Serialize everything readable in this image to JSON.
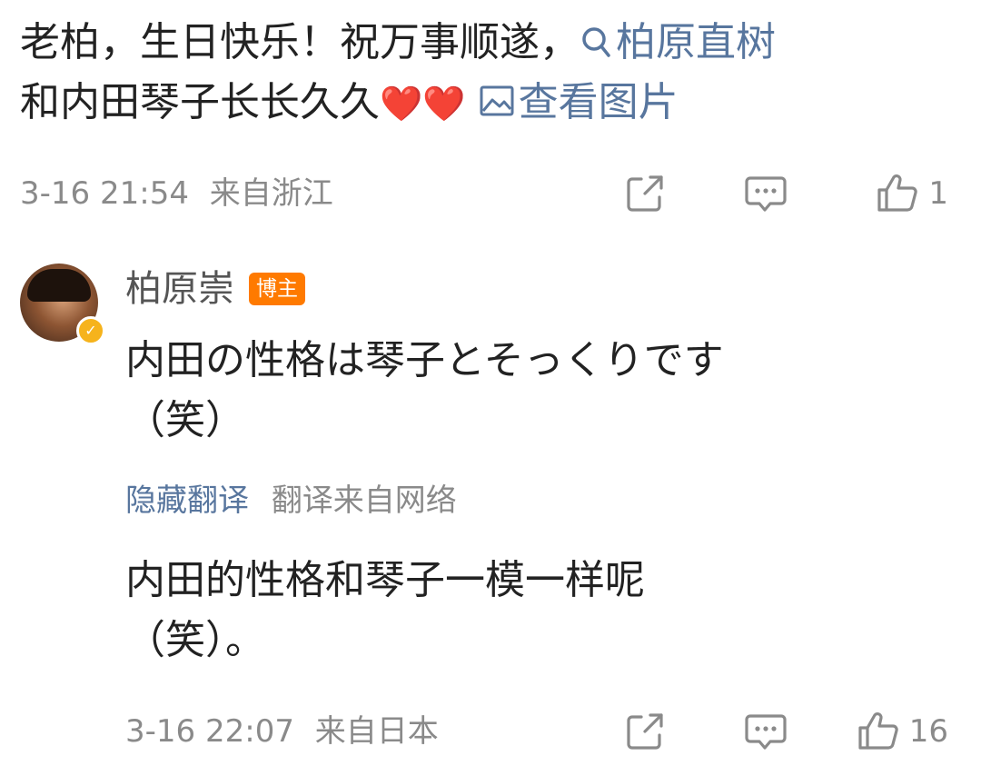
{
  "comment": {
    "line1": "老柏，生日快乐！祝万事顺遂，",
    "tag_link": "柏原直树",
    "line2_text": "和内田琴子长长久久",
    "hearts": "❤️❤️",
    "view_image": "查看图片",
    "time": "3-16 21:54",
    "location": "来自浙江",
    "like_count": "1"
  },
  "reply": {
    "author": "柏原崇",
    "author_badge": "博主",
    "text_line1": "内田の性格は琴子とそっくりです",
    "text_line2": "（笑）",
    "translate_toggle": "隐藏翻译",
    "translate_source": "翻译来自网络",
    "translation_line1": "内田的性格和琴子一模一样呢",
    "translation_line2": "（笑）。",
    "time": "3-16 22:07",
    "location": "来自日本",
    "like_count": "16"
  },
  "colors": {
    "text": "#222222",
    "secondary": "#8a8a8a",
    "link": "#58769e",
    "badge": "#ff7a00",
    "verified": "#f6b31c",
    "heart": "#e8313b"
  },
  "icons": [
    "search-icon",
    "image-icon",
    "share-icon",
    "comment-icon",
    "like-icon",
    "verified-badge-icon"
  ]
}
